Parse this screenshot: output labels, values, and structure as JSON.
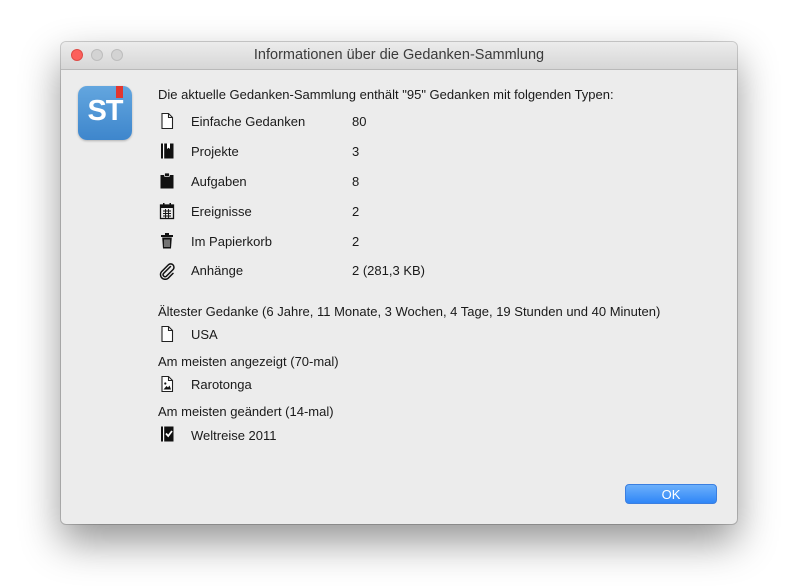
{
  "window": {
    "title": "Informationen über die Gedanken-Sammlung"
  },
  "app_icon": {
    "label": "ST"
  },
  "summary": "Die aktuelle Gedanken-Sammlung enthält \"95\" Gedanken mit folgenden Typen:",
  "types": [
    {
      "icon": "document-icon",
      "label": "Einfache Gedanken",
      "value": "80"
    },
    {
      "icon": "project-icon",
      "label": "Projekte",
      "value": "3"
    },
    {
      "icon": "clipboard-icon",
      "label": "Aufgaben",
      "value": "8"
    },
    {
      "icon": "calendar-icon",
      "label": "Ereignisse",
      "value": "2"
    },
    {
      "icon": "trash-icon",
      "label": "Im Papierkorb",
      "value": "2"
    },
    {
      "icon": "paperclip-icon",
      "label": "Anhänge",
      "value": "2 (281,3 KB)"
    }
  ],
  "oldest": {
    "heading": "Ältester Gedanke (6 Jahre, 11 Monate, 3 Wochen, 4 Tage, 19 Stunden und 40 Minuten)",
    "icon": "document-icon",
    "name": "USA"
  },
  "most_viewed": {
    "heading": "Am meisten angezeigt (70-mal)",
    "icon": "image-document-icon",
    "name": "Rarotonga"
  },
  "most_changed": {
    "heading": "Am meisten geändert (14-mal)",
    "icon": "project-check-icon",
    "name": "Weltreise 2011"
  },
  "buttons": {
    "ok": "OK"
  },
  "colors": {
    "close": "#fc605c",
    "accent": "#2f86f7",
    "app_icon": "#4a90d9"
  }
}
